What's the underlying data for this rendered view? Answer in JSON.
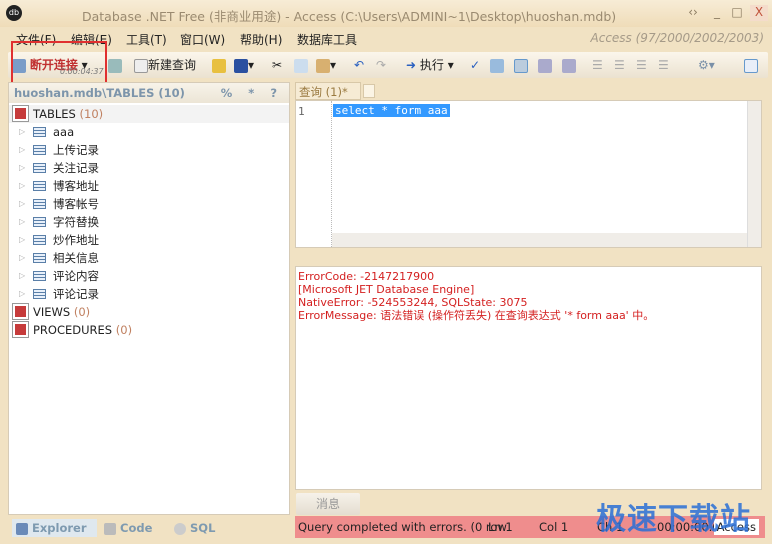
{
  "window": {
    "title": "Database .NET Free (非商业用途)  -  Access (C:\\Users\\ADMINI~1\\Desktop\\huoshan.mdb)",
    "minimize": "_",
    "maximize": "□",
    "close": "X",
    "restore": "‹›"
  },
  "menu": {
    "items": [
      "文件(F)",
      "编辑(E)",
      "工具(T)",
      "窗口(W)",
      "帮助(H)",
      "数据库工具"
    ],
    "access_version": "Access (97/2000/2002/2003)"
  },
  "toolbar": {
    "disconnect": "断开连接",
    "timer": "0.00:04:37",
    "new_query": "新建查询",
    "execute": "执行"
  },
  "explorer": {
    "header": "huoshan.mdb\\TABLES (10)",
    "tools": "% * ?",
    "tables_label": "TABLES",
    "tables_count": "(10)",
    "tables": [
      "aaa",
      "上传记录",
      "关注记录",
      "博客地址",
      "博客帐号",
      "字符替换",
      "炒作地址",
      "相关信息",
      "评论内容",
      "评论记录"
    ],
    "views_label": "VIEWS",
    "views_count": "(0)",
    "procedures_label": "PROCEDURES",
    "procedures_count": "(0)"
  },
  "query_tab": {
    "label": "查询 (1)*",
    "close": "×"
  },
  "editor": {
    "line_number": "1",
    "code": "select * form aaa"
  },
  "messages": [
    "ErrorCode: -2147217900",
    "[Microsoft JET Database Engine]",
    "NativeError: -524553244, SQLState: 3075",
    "ErrorMessage: 语法错误 (操作符丢失) 在查询表达式 '* form aaa' 中。"
  ],
  "message_tab": "消息",
  "status": {
    "text": "Query completed with errors. (0 row",
    "ln": "Ln 1",
    "col": "Col 1",
    "ch": "Ch 1",
    "elapsed": "00:00:00.671",
    "db": "Access",
    "color": "#ef8d8d"
  },
  "bottom_tabs": [
    "Explorer",
    "Code",
    "SQL"
  ],
  "watermark": "极速下载站"
}
